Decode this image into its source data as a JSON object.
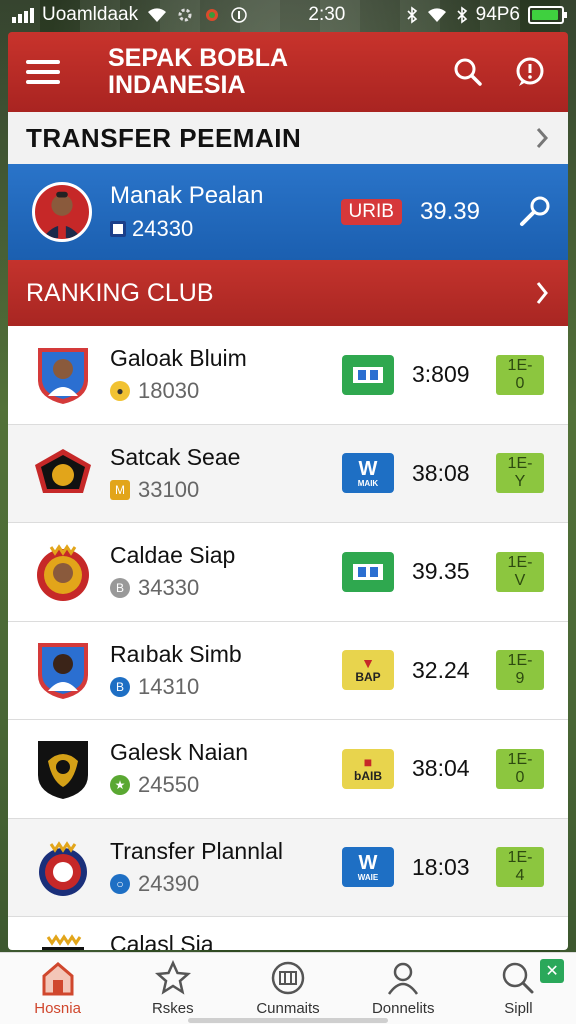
{
  "status": {
    "carrier": "Uoamldaak",
    "time": "2:30",
    "battery": "94P6",
    "icons": [
      "signal-icon",
      "wifi-icon",
      "gear-icon",
      "app-icon",
      "info-icon",
      "bluetooth-icon",
      "battery-icon"
    ]
  },
  "header": {
    "title": "SEPAK BOBLA INDANESIA",
    "search_icon": "search-icon",
    "notification_icon": "alert-icon"
  },
  "transfer": {
    "title": "TRANSFER PEEMAIN",
    "featured": {
      "name": "Manak Pealan",
      "sub": "24330",
      "badge": "URIB",
      "value": "39.39"
    }
  },
  "ranking": {
    "title": "RANKING CLUB",
    "rows": [
      {
        "name": "Galoak Bluim",
        "sub": "18030",
        "logo": "",
        "score": "3:809",
        "tag": "1E-0"
      },
      {
        "name": "Satcak Seae",
        "sub": "33100",
        "logo": "MAIK",
        "score": "38:08",
        "tag": "1E-Y"
      },
      {
        "name": "Caldae Siap",
        "sub": "34330",
        "logo": "",
        "score": "39.35",
        "tag": "1E-V"
      },
      {
        "name": "Raıbak Simb",
        "sub": "14310",
        "logo": "BAP",
        "score": "32.24",
        "tag": "1E-9"
      },
      {
        "name": "Galesk Naian",
        "sub": "24550",
        "logo": "bAIB",
        "score": "38:04",
        "tag": "1E-0"
      },
      {
        "name": "Transfer Plannlal",
        "sub": "24390",
        "logo": "WAIE",
        "score": "18:03",
        "tag": "1E-4"
      },
      {
        "name": "Calasl Sia",
        "sub": "",
        "logo": "",
        "score": "",
        "tag": ""
      }
    ]
  },
  "nav": {
    "items": [
      {
        "label": "Hosnia"
      },
      {
        "label": "Rskes"
      },
      {
        "label": "Cunmaits"
      },
      {
        "label": "Donnelits"
      },
      {
        "label": "Sipll"
      }
    ]
  },
  "colors": {
    "primary_red": "#c8332c",
    "featured_blue": "#2a74c9",
    "tag_green": "#8cc63f",
    "nav_active": "#d0472d"
  }
}
